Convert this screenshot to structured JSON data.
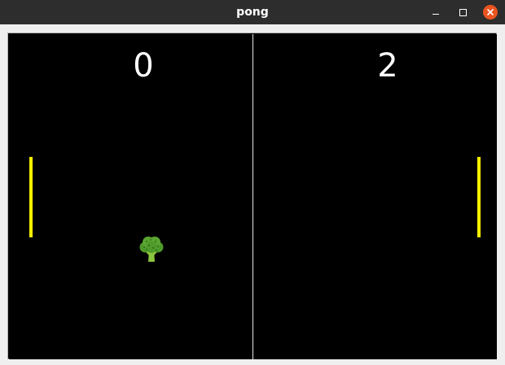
{
  "window": {
    "title": "pong",
    "controls": [
      "minimize-icon",
      "maximize-icon",
      "close-icon"
    ],
    "close_color": "#e95420"
  },
  "game": {
    "score_left": "0",
    "score_right": "2",
    "paddle_color": "#ffee00",
    "net_color": "#e6e6e6",
    "background_color": "#000000",
    "ball_icon": "broccoli-icon"
  }
}
